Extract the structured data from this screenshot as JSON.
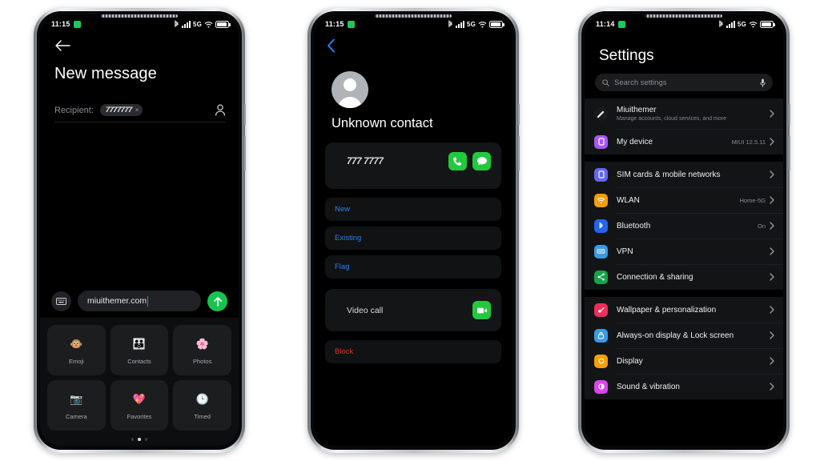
{
  "phone1": {
    "status": {
      "time": "11:15",
      "network": "5G",
      "icons": [
        "alarm-icon",
        "bluetooth-icon",
        "signal-icon",
        "wifi-icon",
        "battery-icon"
      ]
    },
    "back_icon": "back-arrow-icon",
    "title": "New message",
    "recipient_label": "Recipient:",
    "recipient_chip": "7777777",
    "chip_remove": "×",
    "contacts_picker_icon": "person-icon",
    "keyboard_icon": "keyboard-icon",
    "message_value": "miuithemer.com",
    "send_icon": "send-arrow-icon",
    "attachments": [
      {
        "label": "Emoji",
        "icon": "emoji-icon",
        "glyph": "🐵"
      },
      {
        "label": "Contacts",
        "icon": "contacts-icon",
        "glyph": "👪"
      },
      {
        "label": "Photos",
        "icon": "photos-icon",
        "glyph": "🌸"
      },
      {
        "label": "Camera",
        "icon": "camera-icon",
        "glyph": "📷"
      },
      {
        "label": "Favorites",
        "icon": "favorites-icon",
        "glyph": "💖"
      },
      {
        "label": "Timed",
        "icon": "timed-icon",
        "glyph": "🕒"
      }
    ],
    "page_dots": 3,
    "active_dot": 2
  },
  "phone2": {
    "status": {
      "time": "11:15",
      "network": "5G"
    },
    "back_icon": "chevron-left-icon",
    "avatar": "default-avatar-icon",
    "contact_name": "Unknown contact",
    "phone_number": "777 7777",
    "call_icon": "phone-call-icon",
    "message_icon": "message-bubble-icon",
    "actions": [
      {
        "label": "New",
        "color": "#2f7ff0"
      },
      {
        "label": "Existing",
        "color": "#2f7ff0"
      },
      {
        "label": "Flag",
        "color": "#2f7ff0"
      }
    ],
    "video_call_label": "Video call",
    "video_call_icon": "video-camera-icon",
    "block_label": "Block",
    "block_color": "#e2352f"
  },
  "phone3": {
    "status": {
      "time": "11:14",
      "network": "5G"
    },
    "title": "Settings",
    "search": {
      "placeholder": "Search settings",
      "search_icon": "search-icon",
      "mic_icon": "microphone-icon"
    },
    "group1": [
      {
        "label": "Miuithemer",
        "sub": "Manage accounts, cloud services, and more",
        "value": "",
        "icon": "account-avatar-icon",
        "color": "#1a1a1a",
        "round": true,
        "tall": true
      },
      {
        "label": "My device",
        "sub": "",
        "value": "MIUI 12.5.11",
        "icon": "my-device-icon",
        "color": "#a855f7",
        "round": false,
        "tall": false
      }
    ],
    "group2": [
      {
        "label": "SIM cards & mobile networks",
        "value": "",
        "icon": "sim-card-icon",
        "color": "#6366f1"
      },
      {
        "label": "WLAN",
        "value": "Home-5G",
        "icon": "wifi-settings-icon",
        "color": "#f59e0b"
      },
      {
        "label": "Bluetooth",
        "value": "On",
        "icon": "bluetooth-settings-icon",
        "color": "#2563eb"
      },
      {
        "label": "VPN",
        "value": "",
        "icon": "vpn-icon",
        "color": "#3b9ae1"
      },
      {
        "label": "Connection & sharing",
        "value": "",
        "icon": "connection-sharing-icon",
        "color": "#16a34a"
      }
    ],
    "group3": [
      {
        "label": "Wallpaper & personalization",
        "value": "",
        "icon": "wallpaper-icon",
        "color": "#ec2f5b"
      },
      {
        "label": "Always-on display & Lock screen",
        "value": "",
        "icon": "lock-screen-icon",
        "color": "#3b9ae1"
      },
      {
        "label": "Display",
        "value": "",
        "icon": "display-icon",
        "color": "#f59e0b"
      },
      {
        "label": "Sound & vibration",
        "value": "",
        "icon": "sound-vibration-icon",
        "color": "#d946ef"
      }
    ]
  }
}
